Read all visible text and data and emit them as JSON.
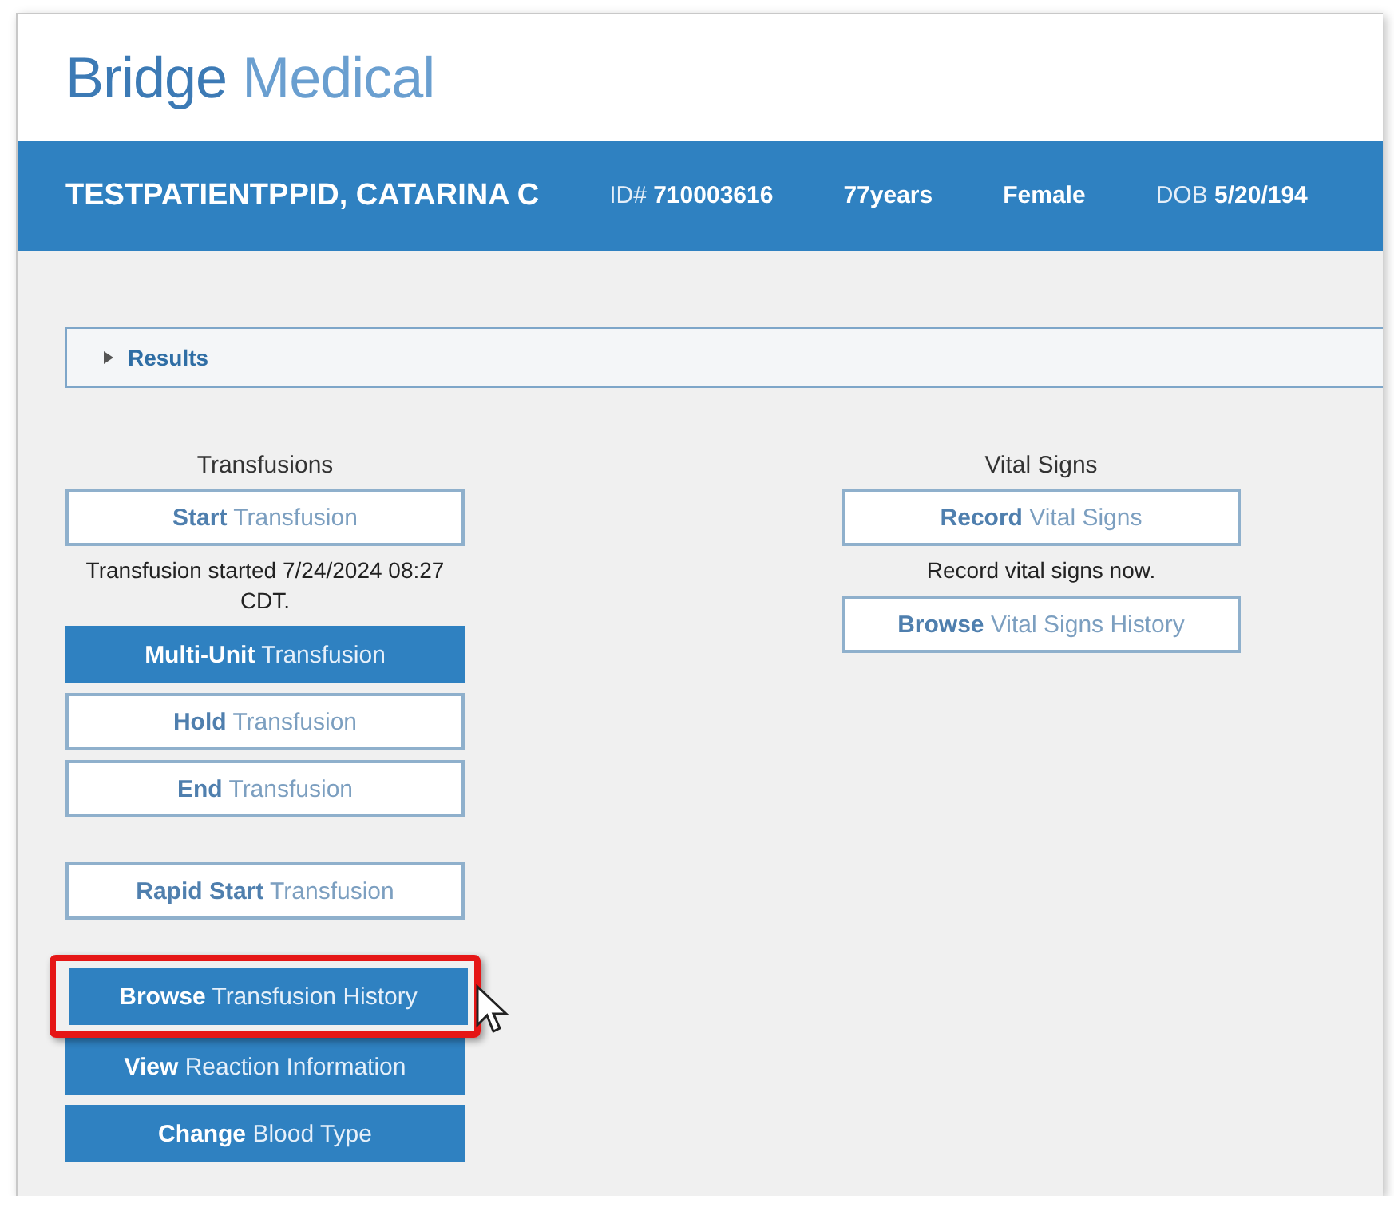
{
  "app_title": {
    "brand": "Bridge",
    "product": "Medical"
  },
  "patient_bar": {
    "name": "TESTPATIENTPPID, CATARINA C",
    "fields": [
      "ID# **710003616**",
      "**77years**",
      "**Female**",
      "DOB **5/20/194**"
    ]
  },
  "results": {
    "label": "Results",
    "expanded": false
  },
  "transfusions": {
    "title": "Transfusions",
    "groups": [
      [
        {
          "kind": "button",
          "filled": false,
          "label": "**Start** Transfusion"
        },
        {
          "kind": "note",
          "text": "Transfusion started 7/24/2024 08:27 CDT."
        },
        {
          "kind": "button",
          "filled": true,
          "label": "**Multi-Unit** Transfusion"
        },
        {
          "kind": "button",
          "filled": false,
          "label": "**Hold** Transfusion"
        },
        {
          "kind": "button",
          "filled": false,
          "label": "**End** Transfusion"
        }
      ],
      [
        {
          "kind": "button",
          "filled": false,
          "label": "**Rapid Start** Transfusion"
        }
      ],
      [
        {
          "kind": "button",
          "filled": true,
          "highlighted": true,
          "label": "**Browse** Transfusion History"
        },
        {
          "kind": "button",
          "filled": true,
          "label": "**View** Reaction Information"
        },
        {
          "kind": "button",
          "filled": true,
          "label": "**Change** Blood Type"
        }
      ]
    ]
  },
  "vital_signs": {
    "title": "Vital Signs",
    "groups": [
      [
        {
          "kind": "button",
          "filled": false,
          "label": "**Record** Vital Signs"
        },
        {
          "kind": "note",
          "text": "Record vital signs now."
        },
        {
          "kind": "button",
          "filled": false,
          "label": "**Browse** Vital Signs History"
        }
      ]
    ]
  }
}
